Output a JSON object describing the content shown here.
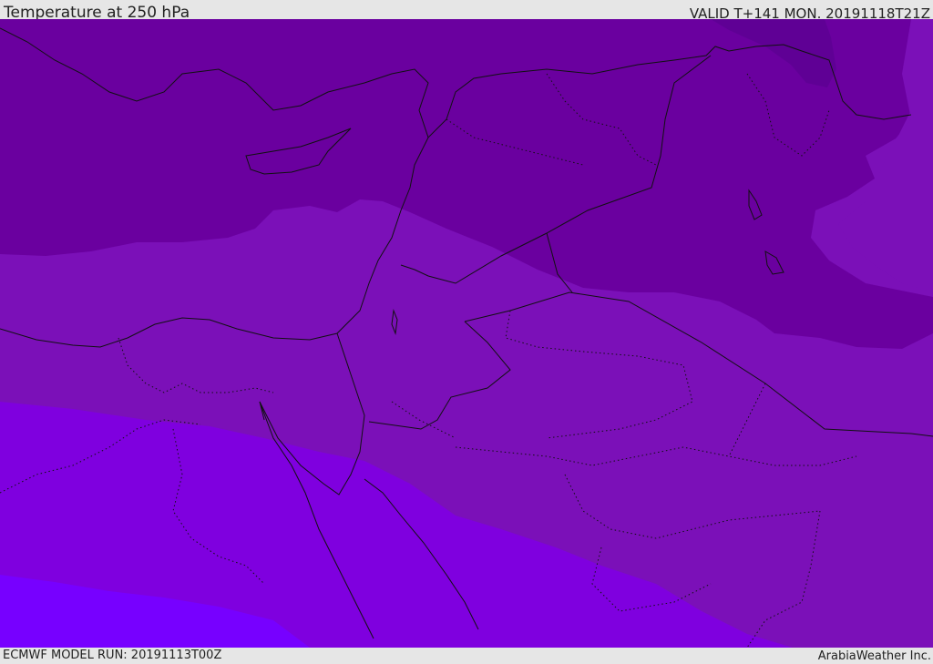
{
  "header": {
    "title": "Temperature at 250 hPa",
    "valid": "VALID T+141 MON. 20191118T21Z"
  },
  "footer": {
    "model_run": "ECMWF MODEL RUN: 20191113T00Z",
    "credit": "ArabiaWeather Inc."
  },
  "colors": {
    "band_darkest": "#5f0095",
    "band_dark": "#6a009f",
    "band_mid": "#7b10b8",
    "band_light": "#7f00df",
    "band_lightest": "#7700ff",
    "header_bg": "#e6e6e6",
    "boundary_line": "#111111"
  }
}
